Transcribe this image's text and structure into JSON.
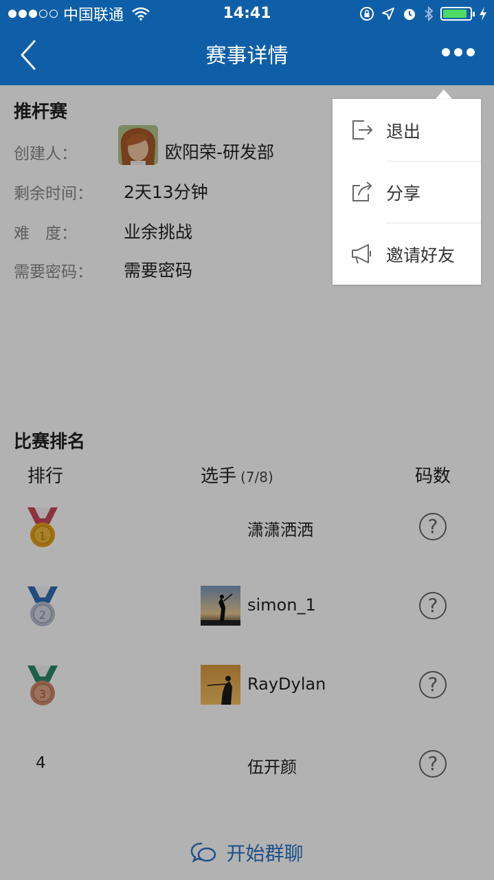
{
  "status_bar": {
    "carrier": "中国联通",
    "time": "14:41",
    "battery_fill": 0.9
  },
  "nav": {
    "title": "赛事详情"
  },
  "event": {
    "section_title": "推杆赛",
    "rows": [
      {
        "label": "创建人：",
        "value": "欧阳荣-研发部"
      },
      {
        "label": "剩余时间：",
        "value": "2天13分钟"
      },
      {
        "label": "难　度：",
        "value": "业余挑战"
      },
      {
        "label": "需要密码：",
        "value": "需要密码"
      }
    ]
  },
  "ranking": {
    "section_title": "比赛排名",
    "col_rank": "排行",
    "col_player": "选手",
    "player_count": "(7/8)",
    "col_strokes": "码数",
    "entries": [
      {
        "rank": "1",
        "medal": "gold",
        "name": "潇潇洒洒",
        "has_avatar": false,
        "strokes": "?"
      },
      {
        "rank": "2",
        "medal": "silver",
        "name": "simon_1",
        "has_avatar": true,
        "strokes": "?"
      },
      {
        "rank": "3",
        "medal": "bronze",
        "name": "RayDylan",
        "has_avatar": true,
        "strokes": "?"
      },
      {
        "rank": "4",
        "medal": null,
        "name": "伍开颜",
        "has_avatar": false,
        "strokes": "?"
      }
    ]
  },
  "footer": {
    "chat_label": "开始群聊"
  },
  "menu": {
    "items": [
      {
        "label": "退出",
        "icon": "exit-icon"
      },
      {
        "label": "分享",
        "icon": "share-icon"
      },
      {
        "label": "邀请好友",
        "icon": "megaphone-icon"
      }
    ]
  },
  "colors": {
    "nav_bg": "#0f5fa8",
    "accent": "#2b73c4",
    "gold": "#e8a317",
    "silver": "#b9bfd0",
    "bronze": "#d08a6a"
  }
}
